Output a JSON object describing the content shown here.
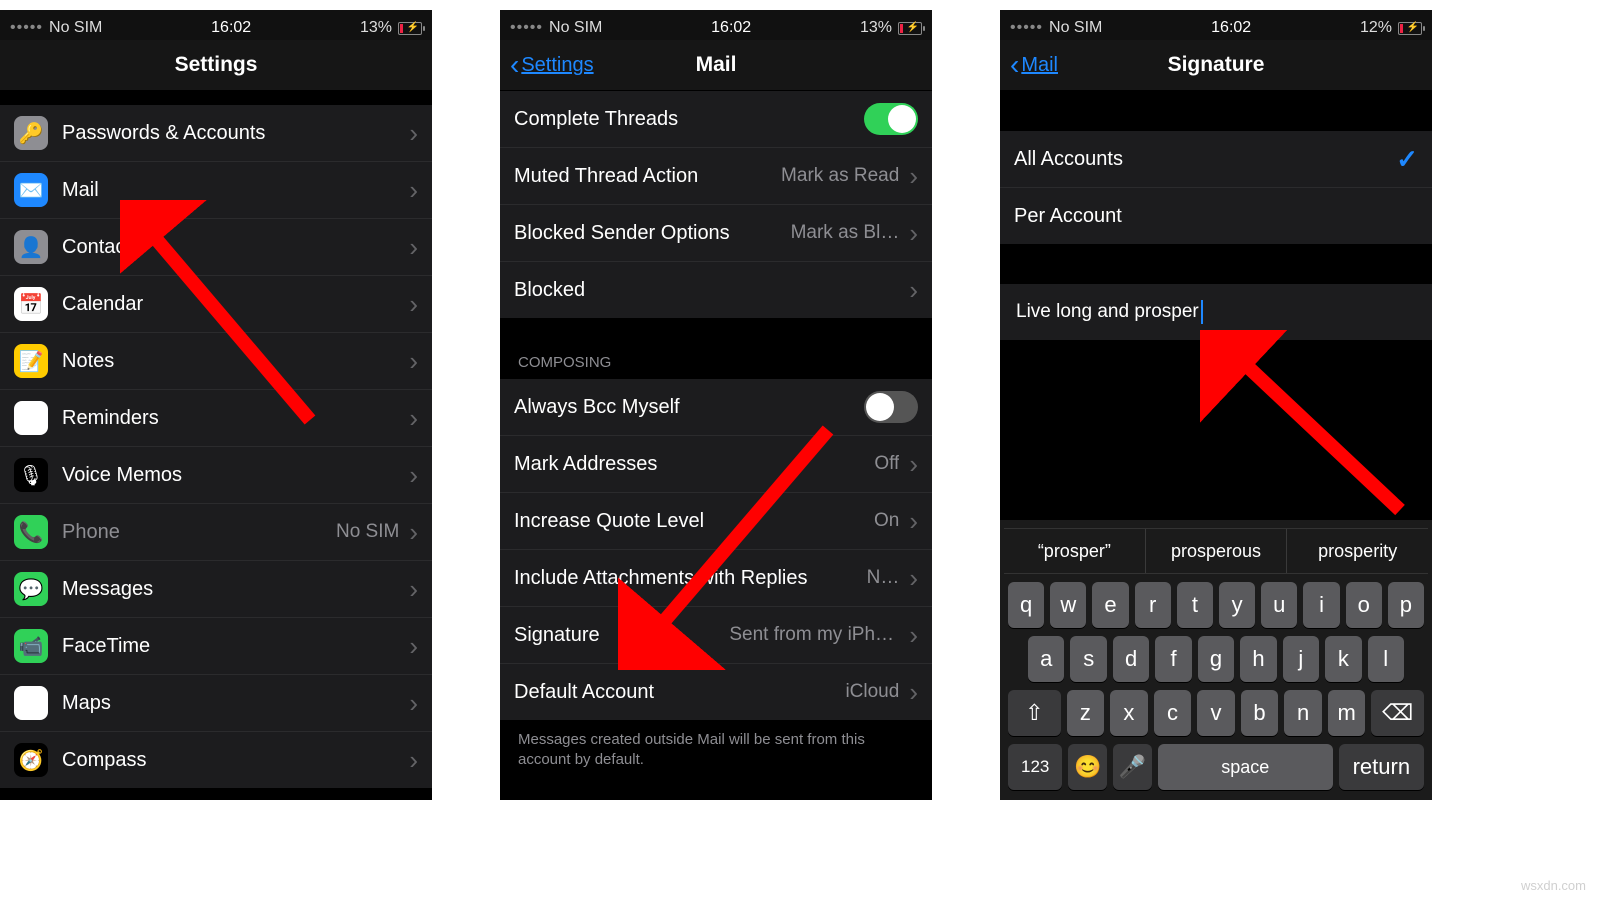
{
  "status": {
    "carrier": "No SIM",
    "time": "16:02",
    "battery13": "13%",
    "battery12": "12%"
  },
  "screen1": {
    "title": "Settings",
    "items": [
      {
        "icon": "🔑",
        "bg": "#8e8e93",
        "label": "Passwords & Accounts",
        "value": ""
      },
      {
        "icon": "✉️",
        "bg": "#1e88ff",
        "label": "Mail",
        "value": ""
      },
      {
        "icon": "👤",
        "bg": "#8e8e93",
        "label": "Contacts",
        "value": ""
      },
      {
        "icon": "📅",
        "bg": "#ffffff",
        "label": "Calendar",
        "value": ""
      },
      {
        "icon": "📝",
        "bg": "#ffcc00",
        "label": "Notes",
        "value": ""
      },
      {
        "icon": "☑︎",
        "bg": "#ffffff",
        "label": "Reminders",
        "value": ""
      },
      {
        "icon": "🎙",
        "bg": "#000000",
        "label": "Voice Memos",
        "value": ""
      },
      {
        "icon": "📞",
        "bg": "#30d158",
        "label": "Phone",
        "value": "No SIM",
        "disabled": true
      },
      {
        "icon": "💬",
        "bg": "#30d158",
        "label": "Messages",
        "value": ""
      },
      {
        "icon": "📹",
        "bg": "#30d158",
        "label": "FaceTime",
        "value": ""
      },
      {
        "icon": "🗺",
        "bg": "#ffffff",
        "label": "Maps",
        "value": ""
      },
      {
        "icon": "🧭",
        "bg": "#000000",
        "label": "Compass",
        "value": ""
      }
    ]
  },
  "screen2": {
    "back": "Settings",
    "title": "Mail",
    "rows_top": [
      {
        "label": "Complete Threads",
        "type": "toggle",
        "on": true
      },
      {
        "label": "Muted Thread Action",
        "type": "value",
        "value": "Mark as Read"
      },
      {
        "label": "Blocked Sender Options",
        "type": "value",
        "value": "Mark as Bl…"
      },
      {
        "label": "Blocked",
        "type": "nav",
        "value": ""
      }
    ],
    "section": "COMPOSING",
    "rows_bottom": [
      {
        "label": "Always Bcc Myself",
        "type": "toggle",
        "on": false
      },
      {
        "label": "Mark Addresses",
        "type": "value",
        "value": "Off"
      },
      {
        "label": "Increase Quote Level",
        "type": "value",
        "value": "On"
      },
      {
        "label": "Include Attachments with Replies",
        "type": "value",
        "value": "N…"
      },
      {
        "label": "Signature",
        "type": "value",
        "value": "Sent from my iPhone"
      },
      {
        "label": "Default Account",
        "type": "value",
        "value": "iCloud"
      }
    ],
    "footnote": "Messages created outside Mail will be sent from this account by default."
  },
  "screen3": {
    "back": "Mail",
    "title": "Signature",
    "opts": [
      {
        "label": "All Accounts",
        "checked": true
      },
      {
        "label": "Per Account",
        "checked": false
      }
    ],
    "signature": "Live long and prosper",
    "suggestions": [
      "“prosper”",
      "prosperous",
      "prosperity"
    ],
    "rows": [
      [
        "q",
        "w",
        "e",
        "r",
        "t",
        "y",
        "u",
        "i",
        "o",
        "p"
      ],
      [
        "a",
        "s",
        "d",
        "f",
        "g",
        "h",
        "j",
        "k",
        "l"
      ],
      [
        "⇧",
        "z",
        "x",
        "c",
        "v",
        "b",
        "n",
        "m",
        "⌫"
      ]
    ],
    "bottom": {
      "num": "123",
      "emoji": "😊",
      "mic": "🎤",
      "space": "space",
      "ret": "return"
    }
  },
  "watermark": "wsxdn.com"
}
